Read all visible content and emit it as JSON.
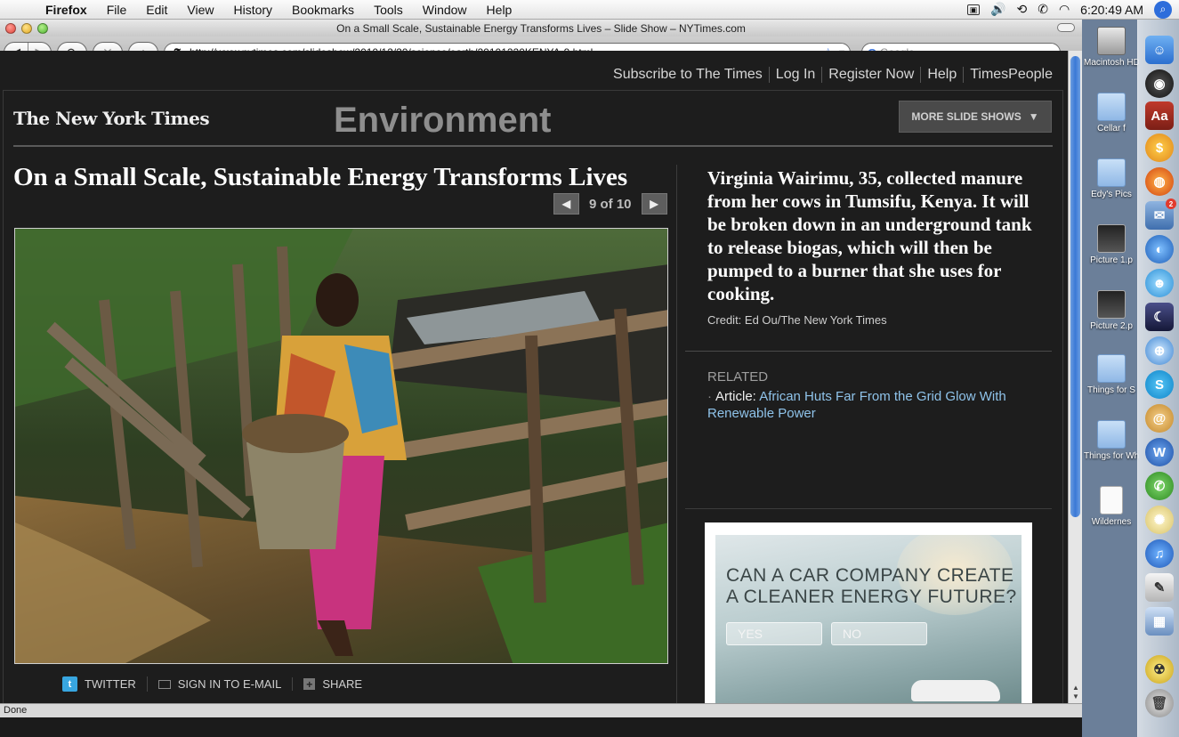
{
  "menubar": {
    "app": "Firefox",
    "items": [
      "File",
      "Edit",
      "View",
      "History",
      "Bookmarks",
      "Tools",
      "Window",
      "Help"
    ],
    "clock": "6:20:49 AM"
  },
  "window": {
    "title": "On a Small Scale, Sustainable Energy Transforms Lives – Slide Show – NYTimes.com"
  },
  "toolbar": {
    "url": "http://www.nytimes.com/slideshow/2010/12/20/science/earth/20101220KENYA-9.html",
    "search_placeholder": "Google"
  },
  "page": {
    "top_links": [
      "Subscribe to The Times",
      "Log In",
      "Register Now",
      "Help",
      "TimesPeople"
    ],
    "logo": "The New York Times",
    "section": "Environment",
    "more_slideshows": "MORE SLIDE SHOWS",
    "headline": "On a Small Scale, Sustainable Energy Transforms Lives",
    "pager": "9 of 10",
    "caption": "Virginia Wairimu, 35, collected manure from her cows in Tumsifu, Kenya. It will be broken down in an underground tank to release biogas, which will then be pumped to a burner that she uses for cooking.",
    "credit": "Credit: Ed Ou/The New York Times",
    "related_heading": "RELATED",
    "related_label": "Article:",
    "related_link": "African Huts Far From the Grid Glow With Renewable Power",
    "share": {
      "twitter": "TWITTER",
      "email": "SIGN IN TO E-MAIL",
      "share": "SHARE"
    },
    "ad": {
      "headline_line1": "CAN A CAR COMPANY CREATE",
      "headline_line2": "A CLEANER ENERGY FUTURE?",
      "yes": "YES",
      "no": "NO"
    }
  },
  "status": "Done",
  "desktop_icons": [
    "Macintosh HD",
    "Cellar f",
    "Edy's Pics",
    "Picture 1.p",
    "Picture 2.p",
    "Things for S",
    "Things for Wh",
    "Wildernes"
  ],
  "dock": {
    "badge": "2"
  }
}
